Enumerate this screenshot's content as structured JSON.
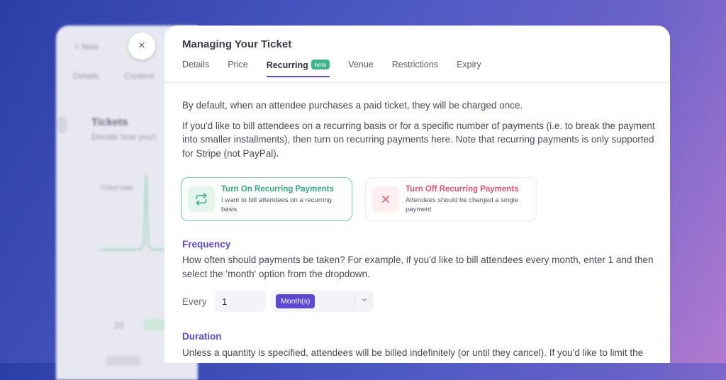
{
  "background": {
    "nav_back": "< New",
    "nav_items": [
      "Details",
      "Content"
    ],
    "section_title": "Tickets",
    "section_sub": "Decide how you'r",
    "chart_label": "Ticket sale",
    "row_text": "20"
  },
  "modal": {
    "close_label": "×",
    "title": "Managing Your Ticket",
    "tabs": [
      {
        "label": "Details"
      },
      {
        "label": "Price"
      },
      {
        "label": "Recurring",
        "badge": "beta"
      },
      {
        "label": "Venue"
      },
      {
        "label": "Restrictions"
      },
      {
        "label": "Expiry"
      }
    ],
    "intro": [
      "By default, when an attendee purchases a paid ticket, they will be charged once.",
      "If you'd like to bill attendees on a recurring basis or for a specific number of payments (i.e. to break the payment into smaller installments), then turn on recurring payments here. Note that recurring payments is only supported for Stripe (not PayPal)."
    ],
    "cards": {
      "on": {
        "title": "Turn On Recurring Payments",
        "sub": "I want to bill attendees on a recurring basis",
        "icon": "repeat-icon"
      },
      "off": {
        "title": "Turn Off Recurring Payments",
        "sub": "Attendees should be charged a single payment",
        "icon": "x-icon"
      }
    },
    "frequency": {
      "title": "Frequency",
      "text": "How often should payments be taken? For example, if you'd like to bill attendees every month, enter 1 and then select the 'month' option from the dropdown.",
      "every_label": "Every",
      "value": "1",
      "unit": "Month(s)"
    },
    "duration": {
      "title": "Duration",
      "text": "Unless a quantity is specified, attendees will be billed indefinitely (or until they cancel). If you'd like to limit the"
    }
  },
  "colors": {
    "accent": "#5a48d6",
    "success": "#3aa982",
    "danger": "#dd5670"
  }
}
